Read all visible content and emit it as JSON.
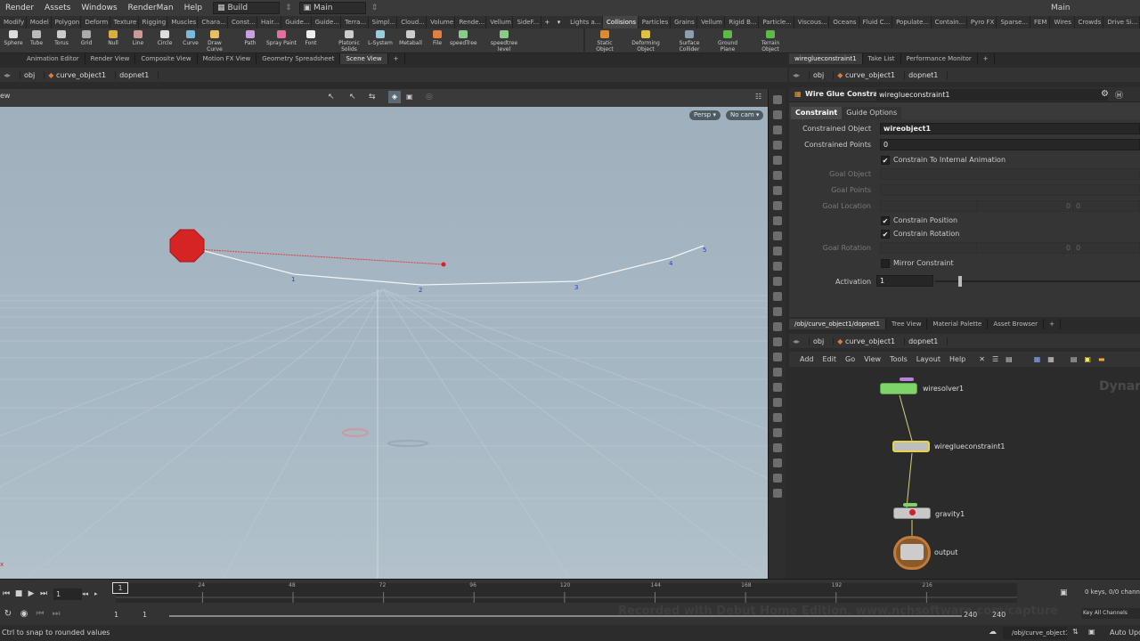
{
  "menubar": {
    "items": [
      "Render",
      "Assets",
      "Windows",
      "RenderMan",
      "Help"
    ],
    "desktop": "Build",
    "network_name": "Main",
    "right_label": "Main"
  },
  "shelf_tabs_left": [
    "Modify",
    "Model",
    "Polygon",
    "Deform",
    "Texture",
    "Rigging",
    "Muscles",
    "Chara...",
    "Const...",
    "Hair...",
    "Guide...",
    "Guide...",
    "Terra...",
    "Simpl...",
    "Cloud...",
    "Volume",
    "Rende...",
    "Vellum",
    "SideF..."
  ],
  "shelf_tabs_right": [
    "Lights a...",
    "Collisions",
    "Particles",
    "Grains",
    "Vellum",
    "Rigid B...",
    "Particle...",
    "Viscous...",
    "Oceans",
    "Fluid C...",
    "Populate...",
    "Contain...",
    "Pyro FX",
    "Sparse...",
    "FEM",
    "Wires",
    "Crowds",
    "Drive Si..."
  ],
  "shelf_tools_left": [
    "Sphere",
    "Tube",
    "Torus",
    "Grid",
    "Null",
    "Line",
    "Circle",
    "Curve",
    "Draw Curve",
    "Path",
    "Spray Paint",
    "Font",
    "Platonic Solids",
    "L-System",
    "Metaball",
    "File",
    "speedTree",
    "speedtree level"
  ],
  "shelf_tools_right": [
    "Static Object",
    "Deforming Object",
    "Surface Collider",
    "Ground Plane",
    "Terrain Object"
  ],
  "viewer_tabs": [
    "Animation Editor",
    "Render View",
    "Composite View",
    "Motion FX View",
    "Geometry Spreadsheet",
    "Scene View"
  ],
  "viewer_path": [
    "obj",
    "curve_object1",
    "dopnet1"
  ],
  "viewport": {
    "left_label": "ew",
    "persp": "Persp ▾",
    "cam": "No cam ▾",
    "point_numbers": [
      "1",
      "2",
      "3",
      "4",
      "5"
    ]
  },
  "params_tabs": [
    "wireglueconstraint1",
    "Take List",
    "Performance Monitor"
  ],
  "params_path": [
    "obj",
    "curve_object1",
    "dopnet1"
  ],
  "params": {
    "node_type": "Wire Glue Constraint",
    "node_name": "wireglueconstraint1",
    "tabs": [
      "Constraint",
      "Guide Options"
    ],
    "constrained_object_label": "Constrained Object",
    "constrained_object_value": "wireobject1",
    "constrained_points_label": "Constrained Points",
    "constrained_points_value": "0",
    "constrain_internal_anim": "Constrain To Internal Animation",
    "goal_object_label": "Goal Object",
    "goal_points_label": "Goal Points",
    "goal_location_label": "Goal Location",
    "goal_location_values": [
      "0",
      "0",
      "0"
    ],
    "constrain_position": "Constrain Position",
    "constrain_rotation": "Constrain Rotation",
    "goal_rotation_label": "Goal Rotation",
    "goal_rotation_values": [
      "0",
      "0",
      "0"
    ],
    "mirror_constraint": "Mirror Constraint",
    "activation_label": "Activation",
    "activation_value": "1"
  },
  "network_tabs": [
    "/obj/curve_object1/dopnet1",
    "Tree View",
    "Material Palette",
    "Asset Browser"
  ],
  "network_path": [
    "obj",
    "curve_object1",
    "dopnet1"
  ],
  "network_menu": [
    "Add",
    "Edit",
    "Go",
    "View",
    "Tools",
    "Layout",
    "Help"
  ],
  "network_watermark": "Dynar",
  "nodes": [
    "wiresolver1",
    "wireglueconstraint1",
    "gravity1",
    "output"
  ],
  "timeline": {
    "frame": "1",
    "ticks": [
      "24",
      "48",
      "72",
      "96",
      "120",
      "144",
      "168",
      "192",
      "216"
    ],
    "range_start": "1",
    "range_start2": "1",
    "range_end": "240",
    "range_end2": "240",
    "marker": "1",
    "keys_info": "0 keys, 0/0 chann",
    "key_all": "Key All Channels",
    "watermark": "Recorded with Debut Home Edition. www.nchsoftware.com/capture"
  },
  "statusbar": {
    "hint": "Ctrl to snap to rounded values",
    "path": "/obj/curve_object1/dopnet1",
    "update": "Auto Upd"
  }
}
